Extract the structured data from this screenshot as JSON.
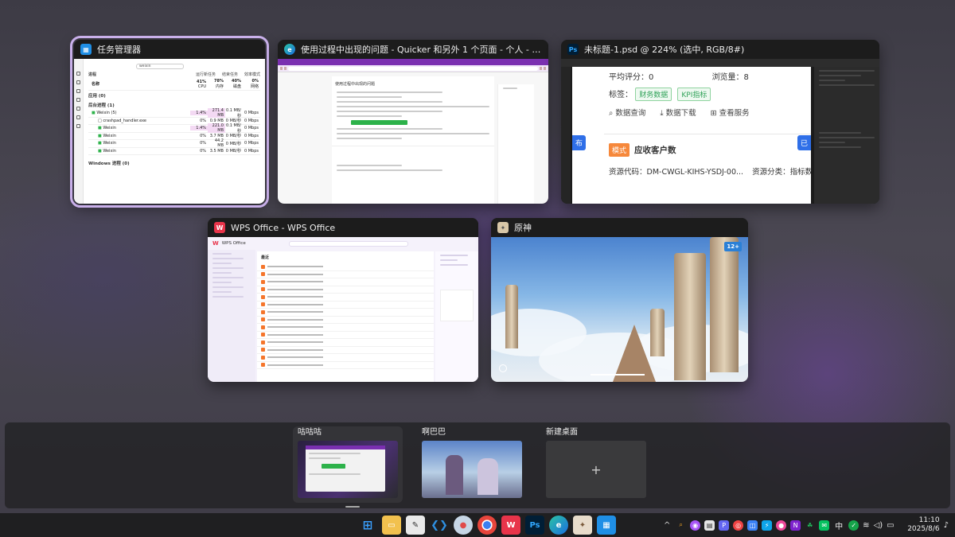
{
  "windows": {
    "taskmgr": {
      "title": "任务管理器",
      "search": "weixin",
      "toolbar": [
        "运行新任务",
        "结束任务",
        "效率模式"
      ],
      "header_label": "进程",
      "cols": {
        "name": "名称",
        "cpu_pct": "41%",
        "cpu": "CPU",
        "mem_pct": "78%",
        "mem": "内存",
        "disk_pct": "40%",
        "disk": "磁盘",
        "net_pct": "0%",
        "net": "网络"
      },
      "group_apps": "应用 (0)",
      "group_bg": "后台进程 (1)",
      "rows": [
        {
          "name": "Weixin (5)",
          "cpu": "1.4%",
          "mem": "271.4 MB",
          "disk": "0.1 MB/秒",
          "net": "0 Mbps"
        },
        {
          "name": "crashpad_handler.exe",
          "cpu": "0%",
          "mem": "0.9 MB",
          "disk": "0 MB/秒",
          "net": "0 Mbps"
        },
        {
          "name": "Weixin",
          "cpu": "1.4%",
          "mem": "221.0 MB",
          "disk": "0.1 MB/秒",
          "net": "0 Mbps"
        },
        {
          "name": "Weixin",
          "cpu": "0%",
          "mem": "3.7 MB",
          "disk": "0 MB/秒",
          "net": "0 Mbps"
        },
        {
          "name": "Weixin",
          "cpu": "0%",
          "mem": "44.2 MB",
          "disk": "0 MB/秒",
          "net": "0 Mbps"
        },
        {
          "name": "Weixin",
          "cpu": "0%",
          "mem": "3.5 MB",
          "disk": "0 MB/秒",
          "net": "0 Mbps"
        }
      ],
      "group_win": "Windows 进程 (0)"
    },
    "edge": {
      "title": "使用过程中出现的问题 - Quicker 和另外 1 个页面 - 个人 - Microsoft Edge",
      "page_heading": "使用过程中出现的问题"
    },
    "ps": {
      "title": "未标题-1.psd @ 224% (选中, RGB/8#)",
      "line1_a": "平均评分：0",
      "line1_b": "浏览量：8",
      "tags_label": "标签：",
      "tags": [
        "财务数据",
        "KPI指标"
      ],
      "actions": [
        "数据查询",
        "数据下载",
        "查看服务"
      ],
      "left_badge": "布",
      "right_badge": "已",
      "mode_badge": "模式",
      "card_title": "应收客户数",
      "code_line": "资源代码：DM-CWGL-KIHS-YSDJ-00...",
      "cat_line": "资源分类：指标数据"
    },
    "wps": {
      "title": "WPS Office - WPS Office",
      "brand": "WPS Office",
      "recent": "最近"
    },
    "genshin": {
      "title": "原神",
      "badge": "12+"
    }
  },
  "desktops": [
    {
      "label": "咕咕咕",
      "active": true
    },
    {
      "label": "啊巴巴",
      "active": false
    },
    {
      "label": "新建桌面",
      "plus": "+"
    }
  ],
  "taskbar": {
    "ime": "中",
    "time": "11:10",
    "date": "2025/8/6",
    "overflow": "^"
  },
  "colors": {
    "selection": "#c9b0ea",
    "edge_purple": "#7a2fb0",
    "ps_green": "#32a35a",
    "ps_blue": "#2f6fe8",
    "wps_red": "#e8344a"
  }
}
